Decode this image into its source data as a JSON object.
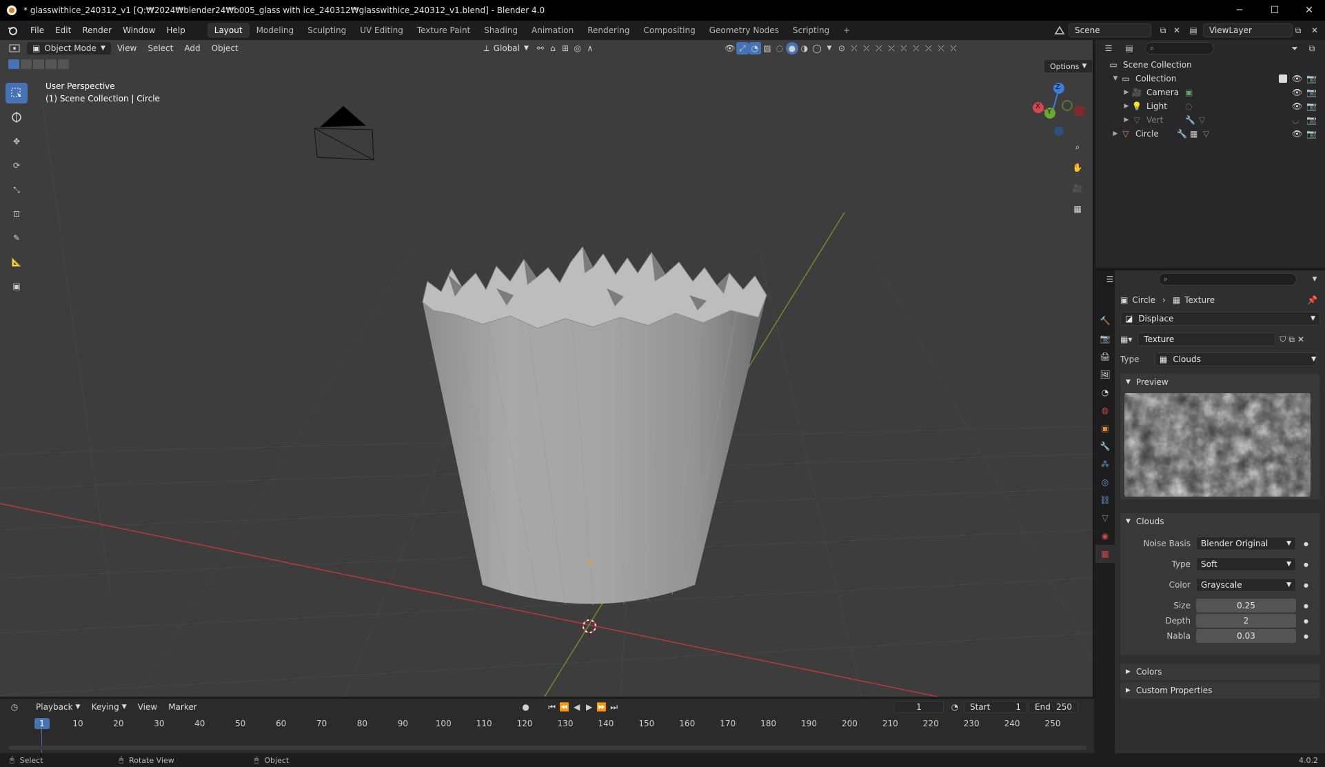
{
  "window": {
    "title": "* glasswithice_240312_v1 [Q:₩2024₩blender24₩b005_glass with ice_240312₩glasswithice_240312_v1.blend] - Blender 4.0",
    "minimize": "─",
    "maximize": "☐",
    "close": "✕"
  },
  "menu": [
    "File",
    "Edit",
    "Render",
    "Window",
    "Help"
  ],
  "workspaces": [
    "Layout",
    "Modeling",
    "Sculpting",
    "UV Editing",
    "Texture Paint",
    "Shading",
    "Animation",
    "Rendering",
    "Compositing",
    "Geometry Nodes",
    "Scripting"
  ],
  "active_workspace": "Layout",
  "scene": {
    "scene_name": "Scene",
    "view_layer": "ViewLayer",
    "add_tab": "+"
  },
  "viewport": {
    "mode": "Object Mode",
    "menus": [
      "View",
      "Select",
      "Add",
      "Object"
    ],
    "transform_orientation": "Global",
    "options": "Options",
    "info_line1": "User Perspective",
    "info_line2": "(1) Scene Collection | Circle",
    "gizmo": {
      "x": "X",
      "y": "Y",
      "z": "Z"
    }
  },
  "timeline": {
    "menus": [
      "Playback",
      "Keying",
      "View",
      "Marker"
    ],
    "current_frame": "1",
    "start_label": "Start",
    "start_value": "1",
    "end_label": "End",
    "end_value": "250",
    "ruler": [
      "1",
      "10",
      "20",
      "30",
      "40",
      "50",
      "60",
      "70",
      "80",
      "90",
      "100",
      "110",
      "120",
      "130",
      "140",
      "150",
      "160",
      "170",
      "180",
      "190",
      "200",
      "210",
      "220",
      "230",
      "240",
      "250"
    ]
  },
  "statusbar": {
    "left": "Select",
    "mid": "Rotate View",
    "right": "Object",
    "version": "4.0.2"
  },
  "outliner": {
    "root": "Scene Collection",
    "collection": "Collection",
    "items": [
      "Camera",
      "Light",
      "Vert",
      "Circle"
    ]
  },
  "properties": {
    "breadcrumb_object": "Circle",
    "breadcrumb_sep": "›",
    "breadcrumb_texture": "Texture",
    "modifier": "Displace",
    "texture_name": "Texture",
    "type_label": "Type",
    "type_value": "Clouds",
    "preview_label": "Preview",
    "clouds_label": "Clouds",
    "noise_basis_label": "Noise Basis",
    "noise_basis_value": "Blender Original",
    "noise_type_label": "Type",
    "noise_type_value": "Soft",
    "color_label": "Color",
    "color_value": "Grayscale",
    "size_label": "Size",
    "size_value": "0.25",
    "depth_label": "Depth",
    "depth_value": "2",
    "nabla_label": "Nabla",
    "nabla_value": "0.03",
    "colors_label": "Colors",
    "custom_props_label": "Custom Properties"
  },
  "colors": {
    "accent": "#4772b3",
    "viewport_bg": "#3d3d3d",
    "x_axis": "#b8383d",
    "y_axis": "#6a8f2a",
    "mesh": "#a6a6a6"
  }
}
